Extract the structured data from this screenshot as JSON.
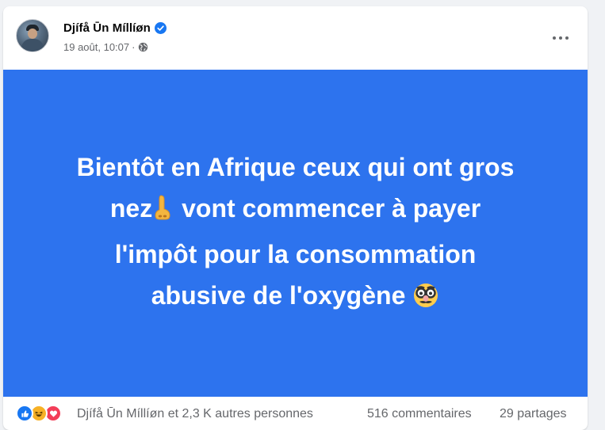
{
  "post": {
    "author": "Djífå Ūn Míllíøn",
    "timestamp": "19 août, 10:07",
    "separator": "·",
    "privacy_icon": "globe-icon",
    "verified_icon": "verified-badge-icon",
    "menu_icon": "more-options-icon",
    "background_color": "#2d73ee",
    "text_lines": [
      "Bientôt en Afrique ceux qui ont gros",
      "nez",
      "vont commencer à payer",
      "l'impôt pour la consommation",
      "abusive de l'oxygène"
    ],
    "emojis": [
      "nose-emoji",
      "disguised-face-emoji"
    ]
  },
  "footer": {
    "reaction_icons": [
      "like-reaction-icon",
      "haha-reaction-icon",
      "love-reaction-icon"
    ],
    "reactions_text": "Djífå Ūn Míllíøn et 2,3 K autres personnes",
    "comments_text": "516 commentaires",
    "shares_text": "29 partages"
  },
  "colors": {
    "accent": "#1877f2",
    "text_secondary": "#65676b",
    "post_text": "#ffffff"
  }
}
